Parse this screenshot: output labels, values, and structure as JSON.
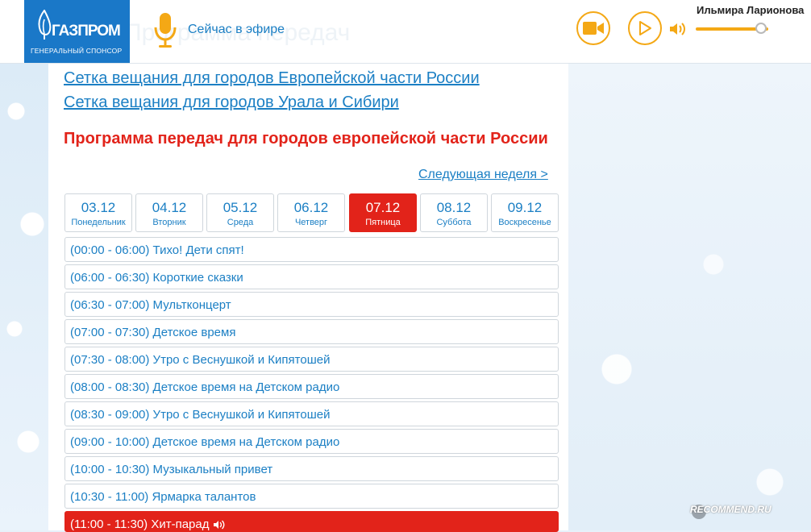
{
  "header": {
    "sponsor_brand": "ГАЗПРОМ",
    "sponsor_sub": "ГЕНЕРАЛЬНЫЙ СПОНСОР",
    "ghost_title": "Программа передач",
    "on_air": "Сейчас в эфире",
    "user_name": "Ильмира Ларионова",
    "volume_level": 0.9
  },
  "links": {
    "europe": "Сетка вещания для городов Европейской части России",
    "ural": "Сетка вещания для городов Урала и Сибири"
  },
  "program_title": "Программа передач для городов европейской части России",
  "next_week": "Следующая неделя >",
  "days": [
    {
      "date": "03.12",
      "weekday": "Понедельник"
    },
    {
      "date": "04.12",
      "weekday": "Вторник"
    },
    {
      "date": "05.12",
      "weekday": "Среда"
    },
    {
      "date": "06.12",
      "weekday": "Четверг"
    },
    {
      "date": "07.12",
      "weekday": "Пятница",
      "active": true
    },
    {
      "date": "08.12",
      "weekday": "Суббота"
    },
    {
      "date": "09.12",
      "weekday": "Воскресенье"
    }
  ],
  "schedule": [
    "(00:00 - 06:00) Тихо! Дети спят!",
    "(06:00 - 06:30) Короткие сказки",
    "(06:30 - 07:00) Мультконцерт",
    "(07:00 - 07:30) Детское время",
    "(07:30 - 08:00) Утро с Веснушкой и Кипятошей",
    "(08:00 - 08:30) Детское время на Детском радио",
    "(08:30 - 09:00) Утро с Веснушкой и Кипятошей",
    "(09:00 - 10:00) Детское время на Детском радио",
    "(10:00 - 10:30) Музыкальный привет",
    "(10:30 - 11:00) Ярмарка талантов",
    "(11:00 - 11:30) Хит-парад"
  ],
  "colors": {
    "accent_blue": "#1b7fc4",
    "accent_red": "#e2231a",
    "accent_orange": "#f4a815",
    "sponsor_blue": "#1a78c8"
  },
  "watermark": "RECOMMEND.RU"
}
